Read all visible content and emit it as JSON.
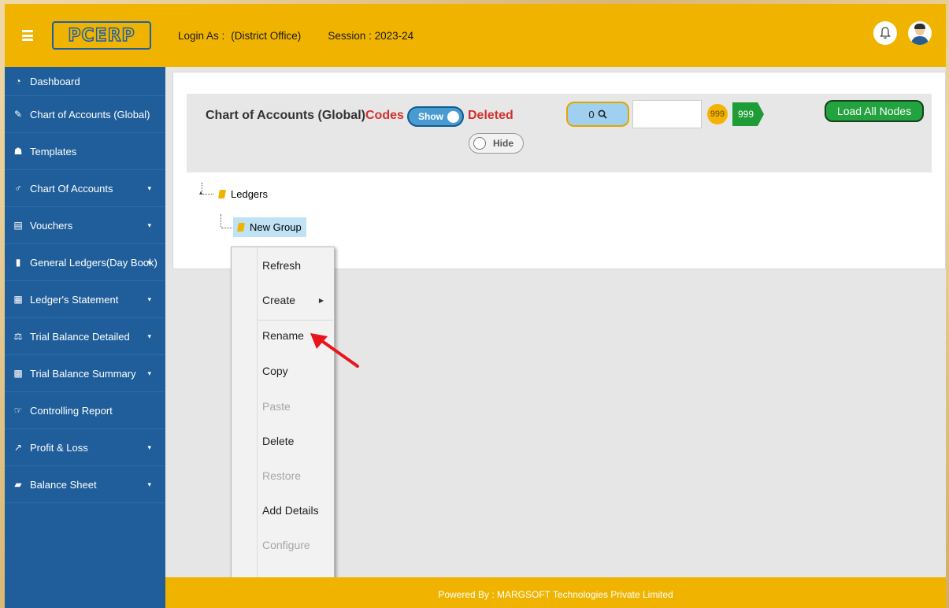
{
  "header": {
    "logo_text": "PCERP",
    "login_label": "Login As :",
    "login_value": "(District Office)",
    "session_label": "Session : 2023-24"
  },
  "sidebar": {
    "items": [
      {
        "label": "Dashboard",
        "icon": "dashboard-icon",
        "has_submenu": false
      },
      {
        "label": "Chart of Accounts (Global)",
        "icon": "wrench-icon",
        "has_submenu": false
      },
      {
        "label": "Templates",
        "icon": "sitemap-icon",
        "has_submenu": false
      },
      {
        "label": "Chart Of Accounts",
        "icon": "gender-icon",
        "has_submenu": true
      },
      {
        "label": "Vouchers",
        "icon": "voucher-icon",
        "has_submenu": true
      },
      {
        "label": "General Ledgers(Day Book)",
        "icon": "book-icon",
        "has_submenu": true
      },
      {
        "label": "Ledger's Statement",
        "icon": "document-icon",
        "has_submenu": true
      },
      {
        "label": "Trial Balance Detailed",
        "icon": "scale-icon",
        "has_submenu": true
      },
      {
        "label": "Trial Balance Summary",
        "icon": "calculator-icon",
        "has_submenu": true
      },
      {
        "label": "Controlling Report",
        "icon": "hand-pointer-icon",
        "has_submenu": false
      },
      {
        "label": "Profit & Loss",
        "icon": "chart-icon",
        "has_submenu": true
      },
      {
        "label": "Balance Sheet",
        "icon": "briefcase-icon",
        "has_submenu": true
      }
    ]
  },
  "toolbar": {
    "title": "Chart of Accounts (Global)",
    "codes_label": "Codes",
    "show_label": "Show",
    "deleted_label": "Deleted",
    "hide_label": "Hide",
    "search_count": "0",
    "search_value": "",
    "badge_yellow": "999",
    "badge_green": "999",
    "load_all_label": "Load All Nodes"
  },
  "tree": {
    "root_label": "Ledgers",
    "child_label": "New Group"
  },
  "context_menu": {
    "items": [
      {
        "label": "Refresh",
        "enabled": true
      },
      {
        "label": "Create",
        "enabled": true,
        "submenu": true
      },
      {
        "label": "Rename",
        "enabled": true
      },
      {
        "label": "Copy",
        "enabled": true
      },
      {
        "label": "Paste",
        "enabled": false
      },
      {
        "label": "Delete",
        "enabled": true
      },
      {
        "label": "Restore",
        "enabled": false
      },
      {
        "label": "Add Details",
        "enabled": true
      },
      {
        "label": "Configure",
        "enabled": false
      }
    ]
  },
  "footer": {
    "text": "Powered By : MARGSOFT Technologies Private Limited"
  },
  "colors": {
    "header_bg": "#f0b400",
    "sidebar_bg": "#1f5e9a",
    "danger_text": "#d0312d",
    "success": "#22a33f"
  }
}
